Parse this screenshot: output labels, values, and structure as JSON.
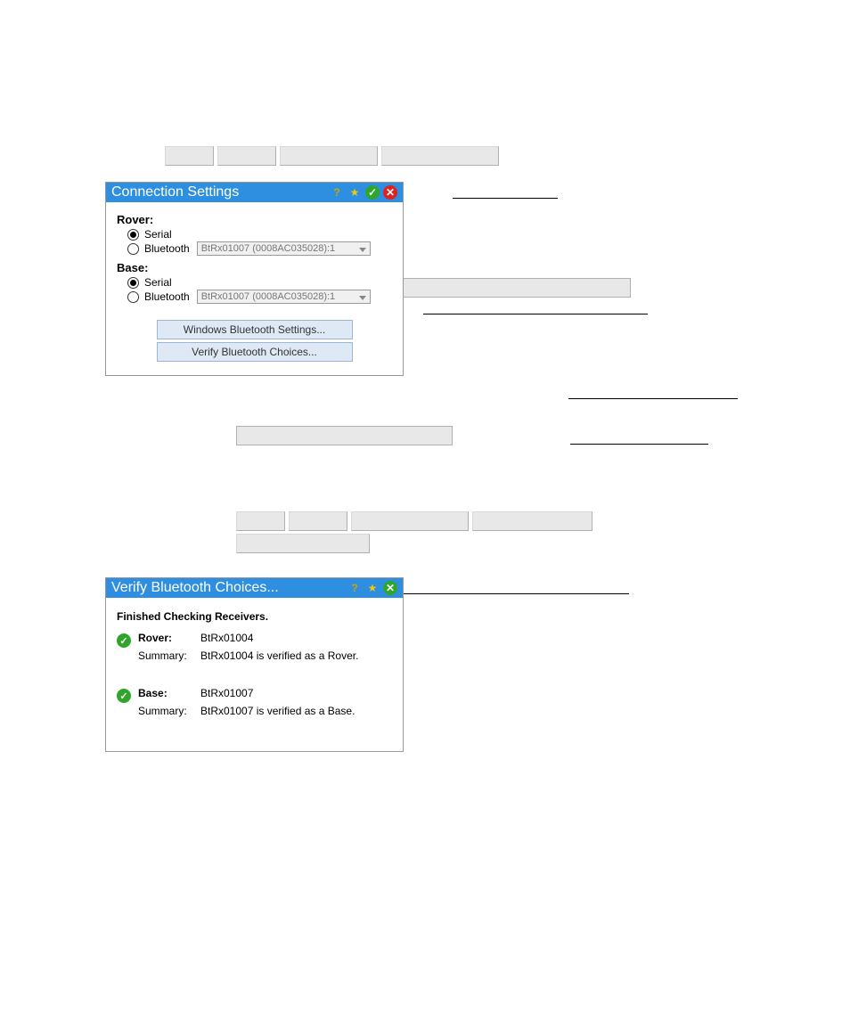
{
  "dialog1": {
    "title": "Connection Settings",
    "rover": {
      "label": "Rover:",
      "serial": "Serial",
      "bluetooth": "Bluetooth",
      "bt_device": "BtRx01007 (0008AC035028):1"
    },
    "base": {
      "label": "Base:",
      "serial": "Serial",
      "bluetooth": "Bluetooth",
      "bt_device": "BtRx01007 (0008AC035028):1"
    },
    "buttons": {
      "win_bt": "Windows Bluetooth Settings...",
      "verify": "Verify Bluetooth Choices..."
    }
  },
  "dialog2": {
    "title": "Verify Bluetooth Choices...",
    "status": "Finished Checking Receivers.",
    "rover": {
      "heading": "Rover:",
      "value": "BtRx01004",
      "summary_label": "Summary:",
      "summary_value": "BtRx01004 is verified as a Rover."
    },
    "base": {
      "heading": "Base:",
      "value": "BtRx01007",
      "summary_label": "Summary:",
      "summary_value": "BtRx01007 is verified as a Base."
    }
  }
}
